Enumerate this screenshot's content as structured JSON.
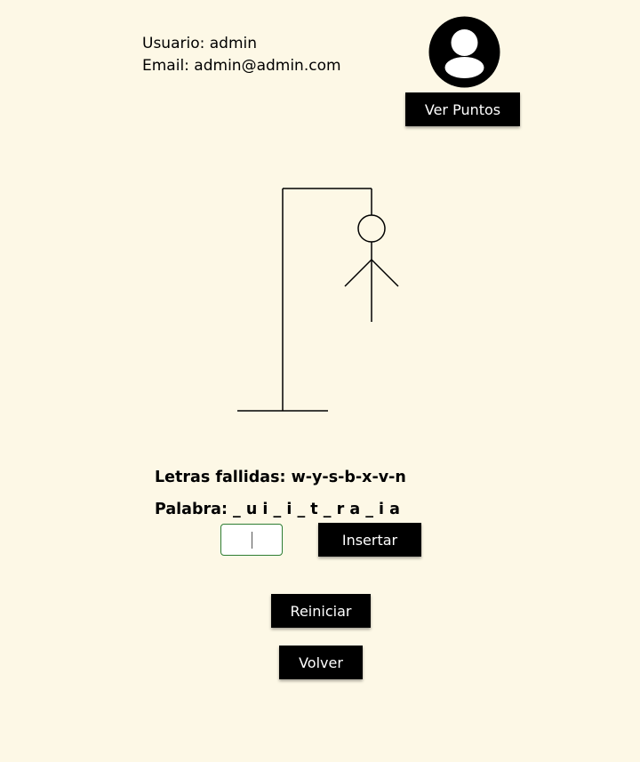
{
  "user": {
    "usuario_label": "Usuario: admin",
    "email_label": "Email: admin@admin.com"
  },
  "icons": {
    "avatar": "user-circle-icon"
  },
  "buttons": {
    "ver_puntos": "Ver Puntos",
    "insertar": "Insertar",
    "reiniciar": "Reiniciar",
    "volver": "Volver"
  },
  "game": {
    "fallidas_label": "Letras fallidas: w-y-s-b-x-v-n",
    "palabra_label": "Palabra: _ u i _ i _ t _ r a _ i a",
    "letter_input_value": ""
  },
  "colors": {
    "background": "#fdf8e6",
    "button": "#000000",
    "input_border": "#2e7d32"
  }
}
